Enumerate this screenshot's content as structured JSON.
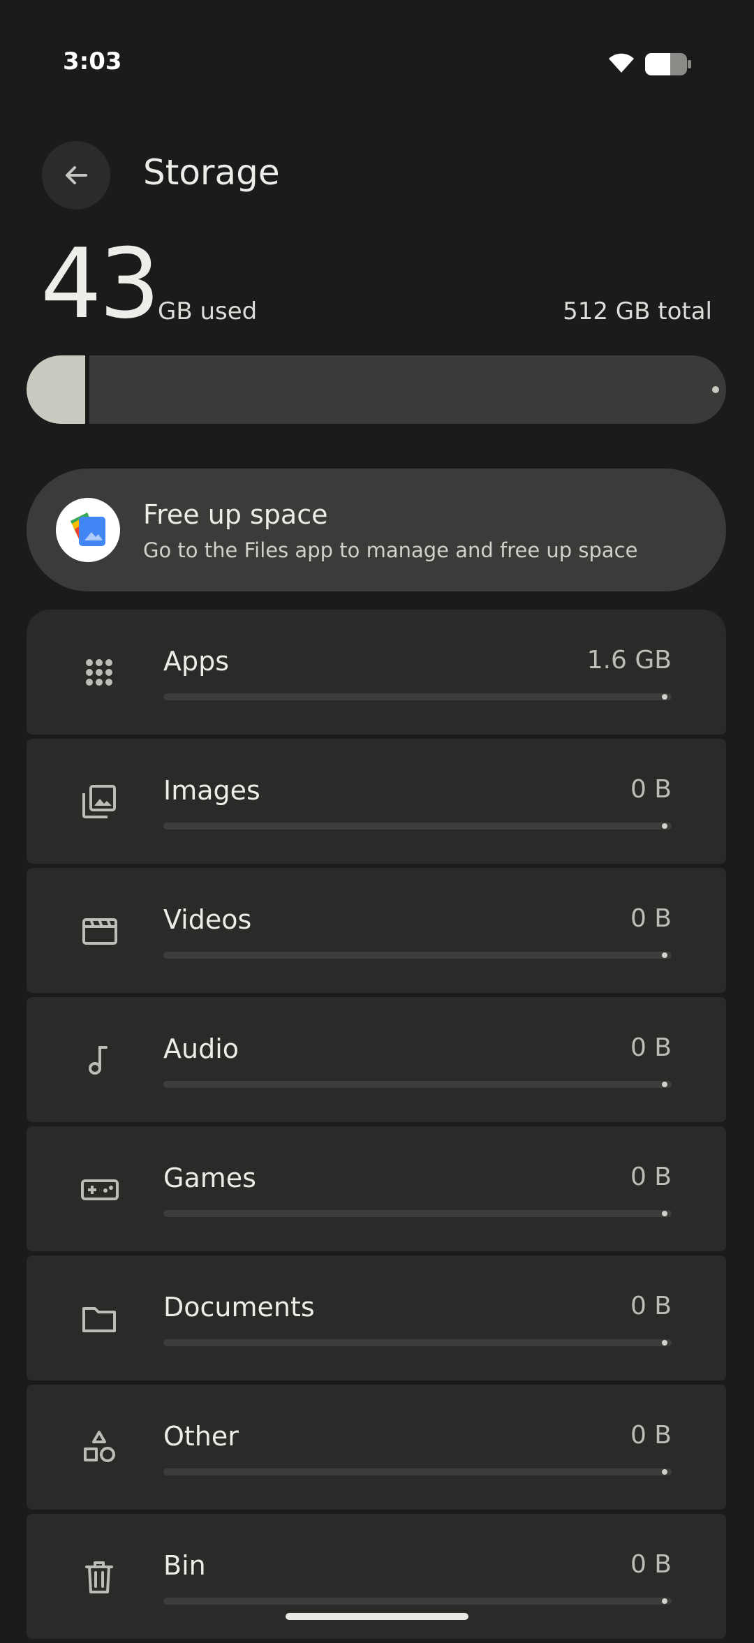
{
  "status_bar": {
    "time": "3:03",
    "wifi_icon": "wifi-icon",
    "battery_icon": "battery-icon"
  },
  "header": {
    "back_icon": "arrow-back-icon",
    "title": "Storage"
  },
  "summary": {
    "used_value": "43",
    "used_unit": "GB used",
    "total": "512 GB total",
    "used_fraction": 0.084
  },
  "free_up": {
    "title": "Free up space",
    "subtitle": "Go to the Files app to manage and free up space",
    "icon": "files-app-icon"
  },
  "categories": [
    {
      "label": "Apps",
      "size": "1.6 GB",
      "icon": "apps-grid-icon",
      "fraction": 0.0
    },
    {
      "label": "Images",
      "size": "0 B",
      "icon": "image-library-icon",
      "fraction": 0.0
    },
    {
      "label": "Videos",
      "size": "0 B",
      "icon": "movie-clapper-icon",
      "fraction": 0.0
    },
    {
      "label": "Audio",
      "size": "0 B",
      "icon": "music-note-icon",
      "fraction": 0.0
    },
    {
      "label": "Games",
      "size": "0 B",
      "icon": "gamepad-icon",
      "fraction": 0.0
    },
    {
      "label": "Documents",
      "size": "0 B",
      "icon": "folder-icon",
      "fraction": 0.0
    },
    {
      "label": "Other",
      "size": "0 B",
      "icon": "shapes-icon",
      "fraction": 0.0
    },
    {
      "label": "Bin",
      "size": "0 B",
      "icon": "trash-icon",
      "fraction": 0.0
    }
  ],
  "colors": {
    "background": "#1b1b1b",
    "card": "#2a2b29",
    "accent": "#c8cbbf"
  }
}
